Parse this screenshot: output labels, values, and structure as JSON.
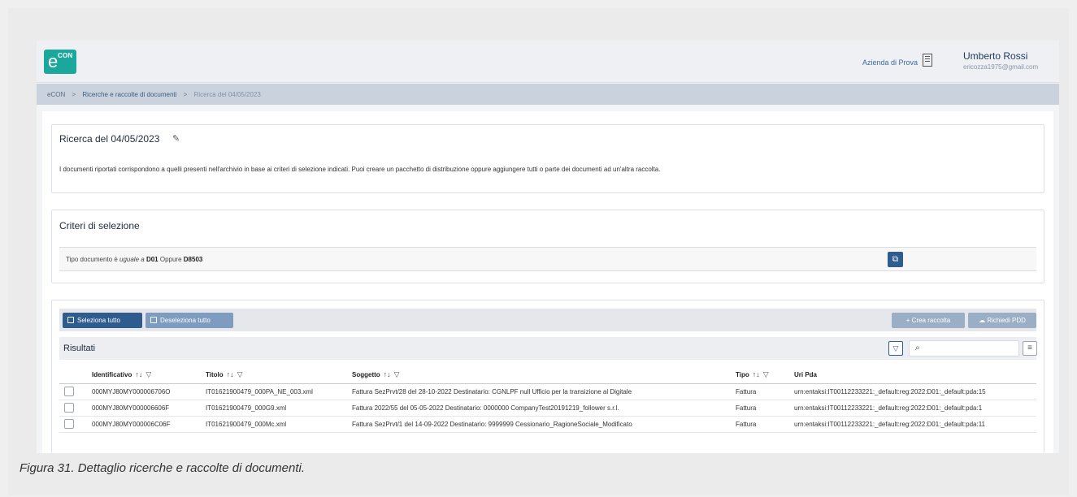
{
  "header": {
    "logo": {
      "e": "e",
      "con": "CON"
    },
    "company": "Azienda di Prova",
    "user_name": "Umberto Rossi",
    "user_email": "ericozza1975@gmail.com"
  },
  "breadcrumb": {
    "items": [
      "eCON",
      "Ricerche e raccolte di documenti",
      "Ricerca del 04/05/2023"
    ],
    "separator": ">"
  },
  "search_card": {
    "title": "Ricerca del 04/05/2023",
    "description": "I documenti riportati corrispondono a quelli presenti nell'archivio in base ai criteri di selezione indicati. Puoi creare un pacchetto di distribuzione oppure aggiungere tutti o parte dei documenti ad un'altra raccolta."
  },
  "criteria_card": {
    "title": "Criteri di selezione",
    "criteria": {
      "field": "Tipo documento",
      "verb": "è",
      "operator": "uguale a",
      "value1": "D01",
      "connector": "Oppure",
      "value2": "D8503"
    }
  },
  "toolbar": {
    "select_all": "Seleziona tutto",
    "deselect_all": "Deseleziona tutto",
    "create_collection": "+ Crea raccolta",
    "request_pdd": "Richiedi PDD"
  },
  "results": {
    "title": "Risultati",
    "search_placeholder": "",
    "columns": [
      "Identificativo",
      "Titolo",
      "Soggetto",
      "Tipo",
      "Uri Pda"
    ],
    "rows": [
      {
        "id": "000MYJ80MY000006706O",
        "titolo": "IT01621900479_000PA_NE_003.xml",
        "soggetto": "Fattura SezPrvt/28 del 28-10-2022 Destinatario: CGNLPF null Ufficio per la transizione al Digitale",
        "tipo": "Fattura",
        "uri": "urn:entaksi:IT00112233221:_default:reg:2022:D01:_default:pda:15"
      },
      {
        "id": "000MYJ80MY000006606F",
        "titolo": "IT01621900479_000G9.xml",
        "soggetto": "Fattura 2022/55 del 05-05-2022 Destinatario: 0000000 CompanyTest20191219_follower s.r.l.",
        "tipo": "Fattura",
        "uri": "urn:entaksi:IT00112233221:_default:reg:2022:D01:_default:pda:1"
      },
      {
        "id": "000MYJ80MY000006C06F",
        "titolo": "IT01621900479_000Mc.xml",
        "soggetto": "Fattura SezPrvt/1 del 14-09-2022 Destinatario: 9999999 Cessionario_RagioneSociale_Modificato",
        "tipo": "Fattura",
        "uri": "urn:entaksi:IT00112233221:_default:reg:2022:D01:_default:pda:11"
      }
    ]
  },
  "caption": "Figura 31. Dettaglio ricerche e raccolte di documenti."
}
